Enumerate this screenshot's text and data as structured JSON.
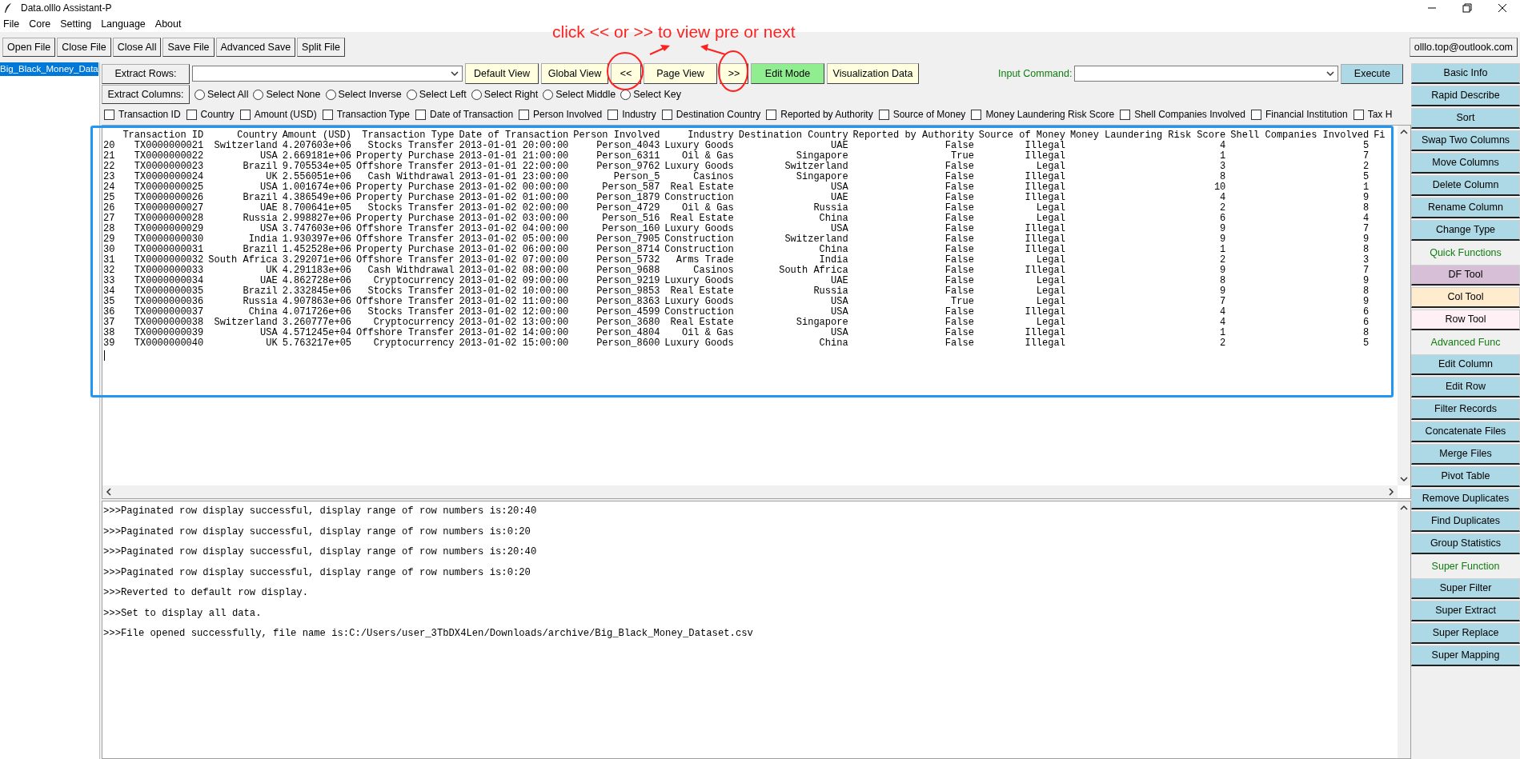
{
  "window": {
    "title": "Data.olllo Assistant-P"
  },
  "menu": [
    "File",
    "Core",
    "Setting",
    "Language",
    "About"
  ],
  "toolbar": [
    "Open File",
    "Close File",
    "Close All",
    "Save File",
    "Advanced Save",
    "Split File"
  ],
  "account": "olllo.top@outlook.com",
  "files": [
    {
      "name": "Big_Black_Money_Data",
      "selected": true
    }
  ],
  "extract_rows": {
    "label": "Extract Rows:"
  },
  "view_buttons": [
    {
      "label": "Default View",
      "kind": "view"
    },
    {
      "label": "Global View",
      "kind": "view"
    },
    {
      "label": "<<",
      "kind": "nav"
    },
    {
      "label": "Page View",
      "kind": "view"
    },
    {
      "label": ">>",
      "kind": "nav"
    },
    {
      "label": "Edit Mode",
      "kind": "mode"
    },
    {
      "label": "Visualization Data",
      "kind": "view"
    }
  ],
  "command": {
    "label": "Input Command:",
    "button": "Execute"
  },
  "extract_columns": {
    "label": "Extract Columns:"
  },
  "select_options": [
    {
      "label": "Select All",
      "selected": false
    },
    {
      "label": "Select None",
      "selected": false
    },
    {
      "label": "Select Inverse",
      "selected": false
    },
    {
      "label": "Select Left",
      "selected": false
    },
    {
      "label": "Select Right",
      "selected": false
    },
    {
      "label": "Select Middle",
      "selected": false
    },
    {
      "label": "Select Key",
      "selected": false
    }
  ],
  "column_checks": [
    {
      "label": "Transaction ID",
      "checked": false
    },
    {
      "label": "Country",
      "checked": false
    },
    {
      "label": "Amount (USD)",
      "checked": false
    },
    {
      "label": "Transaction Type",
      "checked": false
    },
    {
      "label": "Date of Transaction",
      "checked": false
    },
    {
      "label": "Person Involved",
      "checked": false
    },
    {
      "label": "Industry",
      "checked": false
    },
    {
      "label": "Destination Country",
      "checked": false
    },
    {
      "label": "Reported by Authority",
      "checked": false
    },
    {
      "label": "Source of Money",
      "checked": false
    },
    {
      "label": "Money Laundering Risk Score",
      "checked": false
    },
    {
      "label": "Shell Companies Involved",
      "checked": false
    },
    {
      "label": "Financial Institution",
      "checked": false
    },
    {
      "label": "Tax H",
      "checked": false
    }
  ],
  "table": {
    "columns": [
      "",
      "Transaction ID",
      "Country",
      "Amount (USD)",
      "Transaction Type",
      "Date of Transaction",
      "Person Involved",
      "Industry",
      "Destination Country",
      "Reported by Authority",
      "Source of Money",
      "Money Laundering Risk Score",
      "Shell Companies Involved",
      "Fi"
    ],
    "rows": [
      [
        "20",
        "TX0000000021",
        "Switzerland",
        "4.207603e+06",
        "Stocks Transfer",
        "2013-01-01 20:00:00",
        "Person_4043",
        "Luxury Goods",
        "UAE",
        "False",
        "Illegal",
        "4",
        "5"
      ],
      [
        "21",
        "TX0000000022",
        "USA",
        "2.669181e+06",
        "Property Purchase",
        "2013-01-01 21:00:00",
        "Person_6311",
        "Oil & Gas",
        "Singapore",
        "True",
        "Illegal",
        "1",
        "7"
      ],
      [
        "22",
        "TX0000000023",
        "Brazil",
        "9.705534e+05",
        "Offshore Transfer",
        "2013-01-01 22:00:00",
        "Person_9762",
        "Luxury Goods",
        "Switzerland",
        "False",
        "Legal",
        "3",
        "2"
      ],
      [
        "23",
        "TX0000000024",
        "UK",
        "2.556051e+06",
        "Cash Withdrawal",
        "2013-01-01 23:00:00",
        "Person_5",
        "Casinos",
        "Singapore",
        "False",
        "Illegal",
        "8",
        "5"
      ],
      [
        "24",
        "TX0000000025",
        "USA",
        "1.001674e+06",
        "Property Purchase",
        "2013-01-02 00:00:00",
        "Person_587",
        "Real Estate",
        "USA",
        "False",
        "Illegal",
        "10",
        "1"
      ],
      [
        "25",
        "TX0000000026",
        "Brazil",
        "4.386549e+06",
        "Property Purchase",
        "2013-01-02 01:00:00",
        "Person_1879",
        "Construction",
        "UAE",
        "False",
        "Illegal",
        "4",
        "9"
      ],
      [
        "26",
        "TX0000000027",
        "UAE",
        "8.700641e+05",
        "Stocks Transfer",
        "2013-01-02 02:00:00",
        "Person_4729",
        "Oil & Gas",
        "Russia",
        "False",
        "Legal",
        "2",
        "8"
      ],
      [
        "27",
        "TX0000000028",
        "Russia",
        "2.998827e+06",
        "Property Purchase",
        "2013-01-02 03:00:00",
        "Person_516",
        "Real Estate",
        "China",
        "False",
        "Legal",
        "6",
        "4"
      ],
      [
        "28",
        "TX0000000029",
        "USA",
        "3.747603e+06",
        "Offshore Transfer",
        "2013-01-02 04:00:00",
        "Person_160",
        "Luxury Goods",
        "USA",
        "False",
        "Illegal",
        "9",
        "7"
      ],
      [
        "29",
        "TX0000000030",
        "India",
        "1.930397e+06",
        "Offshore Transfer",
        "2013-01-02 05:00:00",
        "Person_7905",
        "Construction",
        "Switzerland",
        "False",
        "Illegal",
        "9",
        "9"
      ],
      [
        "30",
        "TX0000000031",
        "Brazil",
        "1.452528e+06",
        "Property Purchase",
        "2013-01-02 06:00:00",
        "Person_8714",
        "Construction",
        "China",
        "False",
        "Illegal",
        "1",
        "8"
      ],
      [
        "31",
        "TX0000000032",
        "South Africa",
        "3.292071e+06",
        "Offshore Transfer",
        "2013-01-02 07:00:00",
        "Person_5732",
        "Arms Trade",
        "India",
        "False",
        "Legal",
        "2",
        "3"
      ],
      [
        "32",
        "TX0000000033",
        "UK",
        "4.291183e+06",
        "Cash Withdrawal",
        "2013-01-02 08:00:00",
        "Person_9688",
        "Casinos",
        "South Africa",
        "False",
        "Illegal",
        "9",
        "7"
      ],
      [
        "33",
        "TX0000000034",
        "UAE",
        "4.862728e+06",
        "Cryptocurrency",
        "2013-01-02 09:00:00",
        "Person_9219",
        "Luxury Goods",
        "UAE",
        "False",
        "Legal",
        "8",
        "9"
      ],
      [
        "34",
        "TX0000000035",
        "Brazil",
        "2.332845e+06",
        "Stocks Transfer",
        "2013-01-02 10:00:00",
        "Person_9853",
        "Real Estate",
        "Russia",
        "False",
        "Legal",
        "9",
        "8"
      ],
      [
        "35",
        "TX0000000036",
        "Russia",
        "4.907863e+06",
        "Offshore Transfer",
        "2013-01-02 11:00:00",
        "Person_8363",
        "Luxury Goods",
        "USA",
        "True",
        "Legal",
        "7",
        "9"
      ],
      [
        "36",
        "TX0000000037",
        "China",
        "4.071726e+06",
        "Stocks Transfer",
        "2013-01-02 12:00:00",
        "Person_4599",
        "Construction",
        "USA",
        "False",
        "Illegal",
        "4",
        "6"
      ],
      [
        "37",
        "TX0000000038",
        "Switzerland",
        "3.260777e+06",
        "Cryptocurrency",
        "2013-01-02 13:00:00",
        "Person_3680",
        "Real Estate",
        "Singapore",
        "False",
        "Legal",
        "4",
        "6"
      ],
      [
        "38",
        "TX0000000039",
        "USA",
        "4.571245e+04",
        "Offshore Transfer",
        "2013-01-02 14:00:00",
        "Person_4804",
        "Oil & Gas",
        "USA",
        "False",
        "Illegal",
        "1",
        "8"
      ],
      [
        "39",
        "TX0000000040",
        "UK",
        "5.763217e+05",
        "Cryptocurrency",
        "2013-01-02 15:00:00",
        "Person_8600",
        "Luxury Goods",
        "China",
        "False",
        "Illegal",
        "2",
        "5"
      ]
    ]
  },
  "log": [
    ">>>Paginated row display successful, display range of row numbers is:20:40",
    ">>>Paginated row display successful, display range of row numbers is:0:20",
    ">>>Paginated row display successful, display range of row numbers is:20:40",
    ">>>Paginated row display successful, display range of row numbers is:0:20",
    ">>>Reverted to default row display.",
    ">>>Set to display all data.",
    ">>>File opened successfully, file name is:C:/Users/user_3TbDX4Len/Downloads/archive/Big_Black_Money_Dataset.csv"
  ],
  "sidebar": [
    {
      "label": "Basic Info",
      "kind": "button",
      "color": "#add8e6"
    },
    {
      "label": "Rapid Describe",
      "kind": "button",
      "color": "#add8e6"
    },
    {
      "label": "Sort",
      "kind": "button",
      "color": "#add8e6"
    },
    {
      "label": "Swap Two Columns",
      "kind": "button",
      "color": "#add8e6"
    },
    {
      "label": "Move Columns",
      "kind": "button",
      "color": "#add8e6"
    },
    {
      "label": "Delete Column",
      "kind": "button",
      "color": "#add8e6"
    },
    {
      "label": "Rename Column",
      "kind": "button",
      "color": "#add8e6"
    },
    {
      "label": "Change Type",
      "kind": "button",
      "color": "#add8e6"
    },
    {
      "label": "Quick Functions",
      "kind": "section"
    },
    {
      "label": "DF Tool",
      "kind": "button",
      "color": "#d8bfd8"
    },
    {
      "label": "Col Tool",
      "kind": "button",
      "color": "#ffebcd"
    },
    {
      "label": "Row Tool",
      "kind": "button",
      "color": "#fff0f5"
    },
    {
      "label": "Advanced Func",
      "kind": "section"
    },
    {
      "label": "Edit Column",
      "kind": "button",
      "color": "#add8e6"
    },
    {
      "label": "Edit Row",
      "kind": "button",
      "color": "#add8e6"
    },
    {
      "label": "Filter Records",
      "kind": "button",
      "color": "#add8e6"
    },
    {
      "label": "Concatenate Files",
      "kind": "button",
      "color": "#add8e6"
    },
    {
      "label": "Merge Files",
      "kind": "button",
      "color": "#add8e6"
    },
    {
      "label": "Pivot Table",
      "kind": "button",
      "color": "#add8e6"
    },
    {
      "label": "Remove Duplicates",
      "kind": "button",
      "color": "#add8e6"
    },
    {
      "label": "Find Duplicates",
      "kind": "button",
      "color": "#add8e6"
    },
    {
      "label": "Group Statistics",
      "kind": "button",
      "color": "#add8e6"
    },
    {
      "label": "Super Function",
      "kind": "section"
    },
    {
      "label": "Super Filter",
      "kind": "button",
      "color": "#add8e6"
    },
    {
      "label": "Super Extract",
      "kind": "button",
      "color": "#add8e6"
    },
    {
      "label": "Super Replace",
      "kind": "button",
      "color": "#add8e6"
    },
    {
      "label": "Super Mapping",
      "kind": "button",
      "color": "#add8e6"
    }
  ],
  "annotation": "click << or >> to view pre or next"
}
